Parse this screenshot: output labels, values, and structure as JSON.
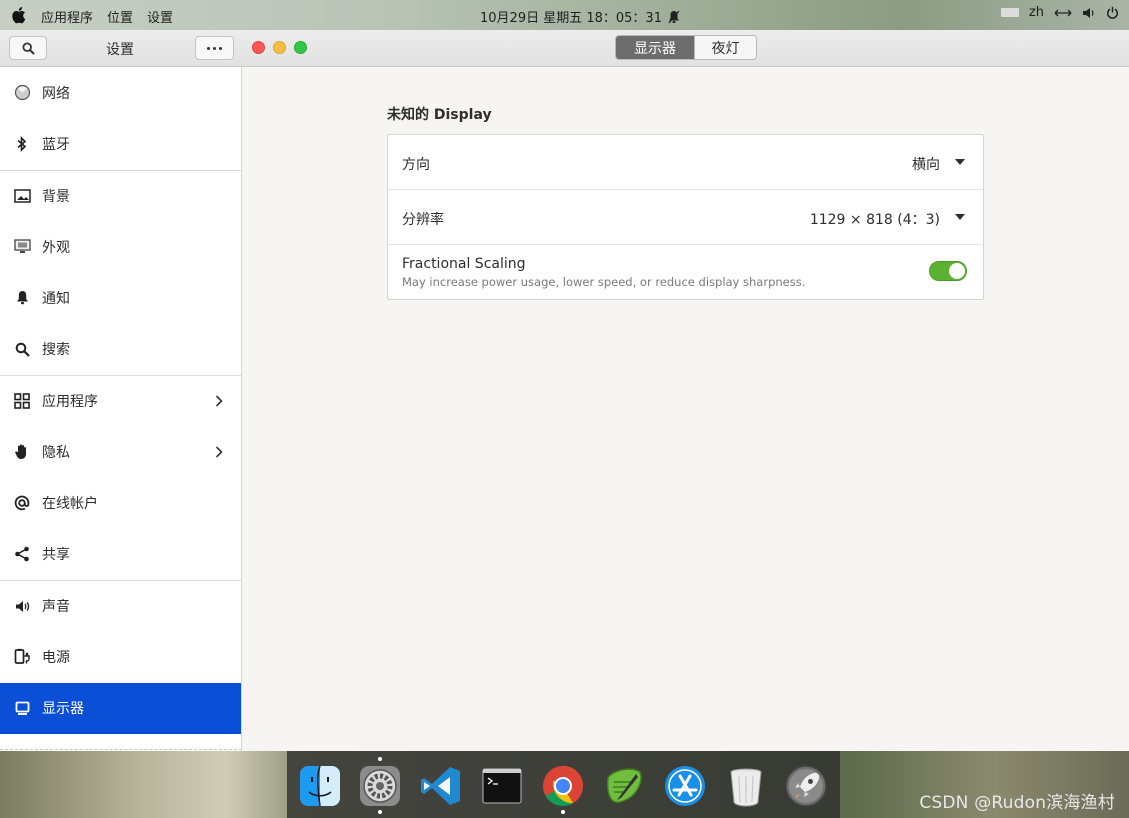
{
  "top_panel": {
    "menus": [
      "应用程序",
      "位置",
      "设置"
    ],
    "clock": "10月29日 星期五  18：05：31",
    "lang": "zh"
  },
  "window": {
    "title": "设置",
    "tabs": [
      {
        "label": "显示器",
        "active": true
      },
      {
        "label": "夜灯",
        "active": false
      }
    ]
  },
  "sidebar": {
    "items": [
      {
        "label": "网络",
        "icon": "network-icon"
      },
      {
        "label": "蓝牙",
        "icon": "bluetooth-icon"
      },
      {
        "label": "背景",
        "icon": "background-icon"
      },
      {
        "label": "外观",
        "icon": "appearance-icon"
      },
      {
        "label": "通知",
        "icon": "bell-icon"
      },
      {
        "label": "搜索",
        "icon": "search-icon"
      },
      {
        "label": "应用程序",
        "icon": "apps-grid-icon"
      },
      {
        "label": "隐私",
        "icon": "hand-icon"
      },
      {
        "label": "在线帐户",
        "icon": "at-icon"
      },
      {
        "label": "共享",
        "icon": "share-icon"
      },
      {
        "label": "声音",
        "icon": "speaker-icon"
      },
      {
        "label": "电源",
        "icon": "power-plug-icon"
      },
      {
        "label": "显示器",
        "icon": "monitor-icon",
        "selected": true
      }
    ],
    "selected_color": "#0a4fd6"
  },
  "display": {
    "section_title": "未知的 Display",
    "orientation": {
      "label": "方向",
      "value": "横向"
    },
    "resolution": {
      "label": "分辨率",
      "value": "1129 × 818 (4：3)"
    },
    "fractional_scaling": {
      "label": "Fractional Scaling",
      "description": "May increase power usage, lower speed, or reduce display sharpness.",
      "enabled": true
    }
  },
  "dock": {
    "apps": [
      "finder-icon",
      "system-preferences-icon",
      "vscode-icon",
      "terminal-icon",
      "chrome-icon",
      "text-editor-icon",
      "app-store-icon",
      "trash-icon",
      "launchpad-icon"
    ]
  },
  "watermark": "CSDN @Rudon滨海渔村"
}
